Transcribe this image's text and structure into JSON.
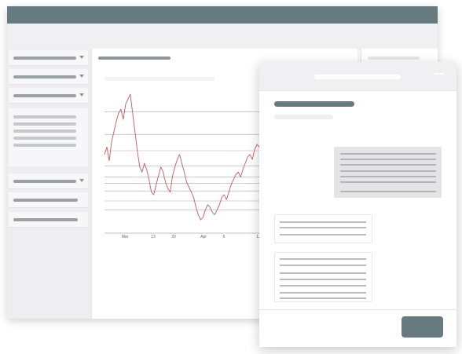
{
  "chart_data": {
    "type": "line",
    "tick_labels": [
      "Mar",
      "13",
      "20",
      "Apr",
      "6",
      "13"
    ],
    "ylim": [
      0,
      100
    ],
    "grid": true,
    "color": "#c25c5c",
    "reference_lines": [
      86,
      68,
      55,
      43,
      34,
      29,
      23,
      15,
      8
    ],
    "highlight_line": 55,
    "values": [
      52,
      58,
      47,
      62,
      70,
      78,
      85,
      88,
      80,
      92,
      96,
      100,
      85,
      70,
      55,
      42,
      38,
      45,
      40,
      32,
      22,
      20,
      28,
      35,
      42,
      38,
      30,
      25,
      22,
      35,
      42,
      48,
      52,
      45,
      38,
      30,
      26,
      22,
      18,
      10,
      4,
      0,
      2,
      8,
      12,
      10,
      6,
      4,
      8,
      12,
      18,
      20,
      16,
      22,
      28,
      32,
      36,
      38,
      34,
      40,
      45,
      50,
      52,
      48,
      56,
      60,
      58,
      52,
      48,
      44
    ]
  },
  "colors": {
    "titlebar": "#677a80",
    "primary_button": "#677a80"
  }
}
